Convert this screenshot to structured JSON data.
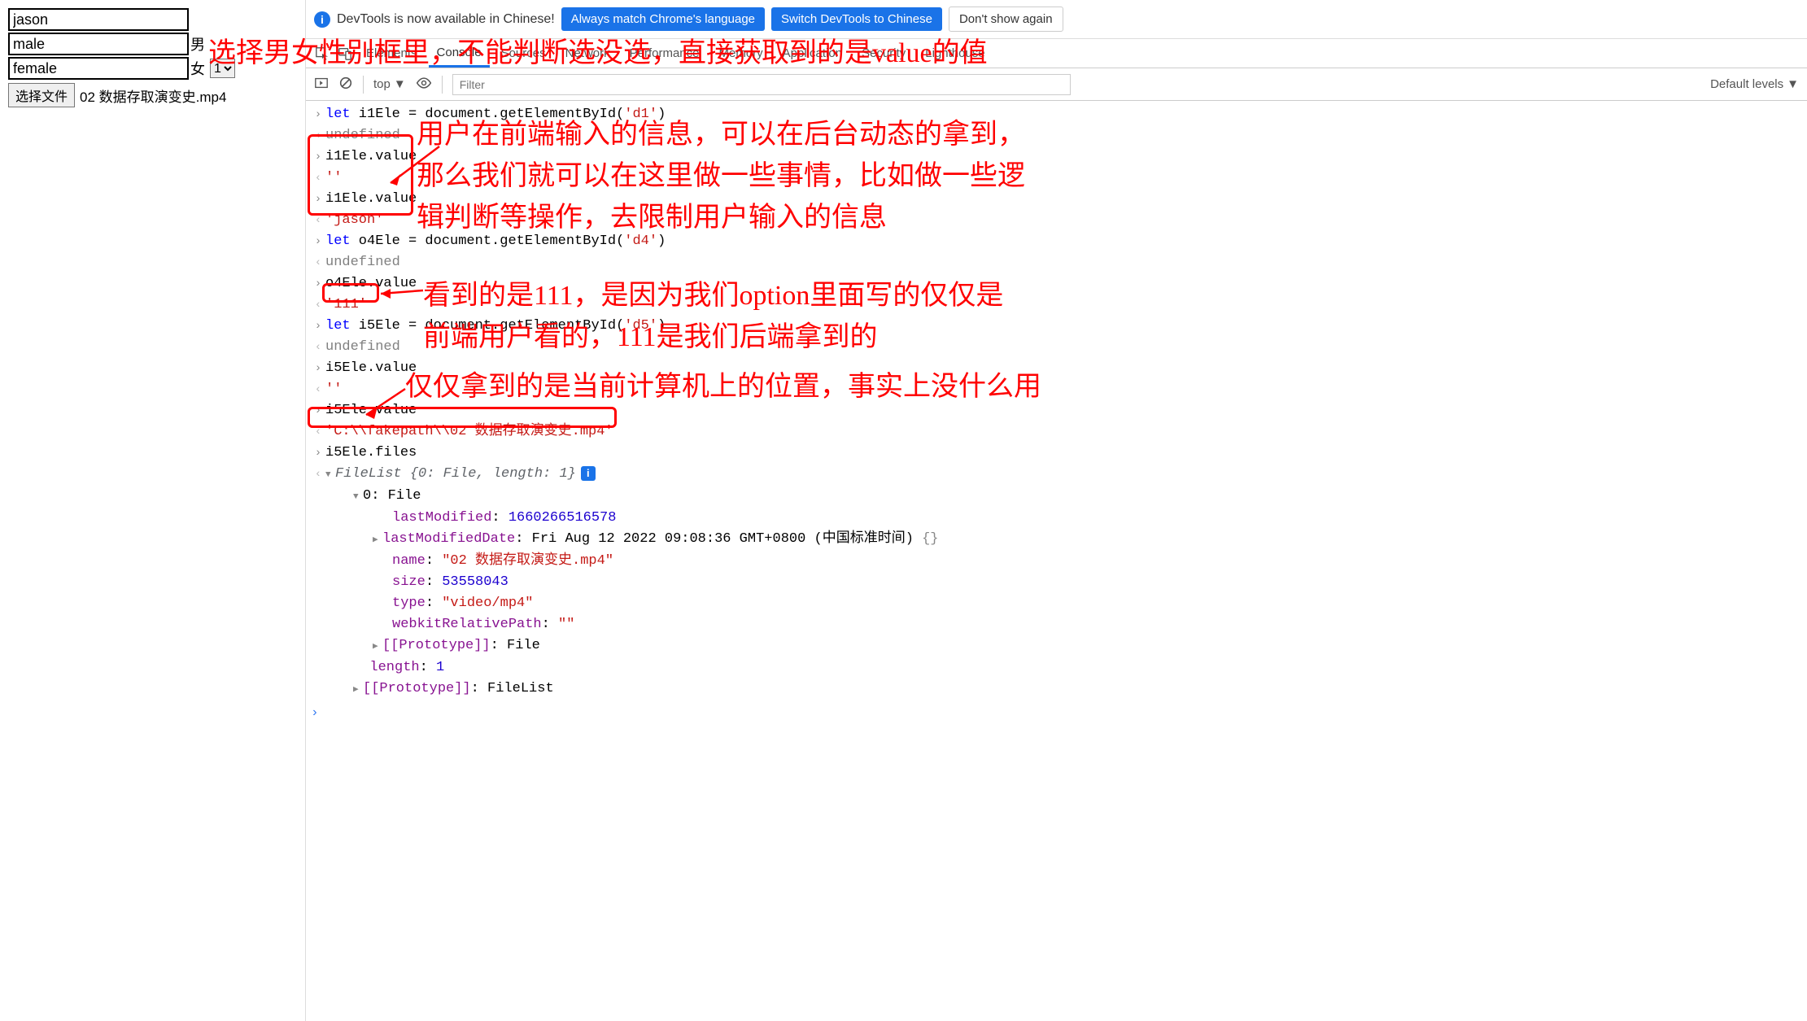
{
  "form": {
    "name_value": "jason",
    "male_value": "male",
    "male_label": "男",
    "female_value": "female",
    "female_label": "女",
    "select_value": "1",
    "file_button": "选择文件",
    "file_name": "02 数据存取演变史.mp4"
  },
  "infobar": {
    "text": "DevTools is now available in Chinese!",
    "btn_always": "Always match Chrome's language",
    "btn_switch": "Switch DevTools to Chinese",
    "btn_dont": "Don't show again"
  },
  "tabs": {
    "elements": "Elements",
    "console": "Console",
    "sources": "Sources",
    "network": "Network",
    "performance": "Performance",
    "memory": "Memory",
    "application": "Application",
    "security": "Security",
    "lighthouse": "Lighthouse"
  },
  "toolbar": {
    "context": "top",
    "filter_placeholder": "Filter",
    "levels": "Default levels"
  },
  "console_lines": {
    "l1_let": "let",
    "l1_rest": " i1Ele = document.getElementById(",
    "l1_arg": "'d1'",
    "l1_close": ")",
    "undefined": "undefined",
    "l3": "i1Ele.value",
    "l4": "''",
    "l5": "i1Ele.value",
    "l6": "'jason'",
    "l7_let": "let",
    "l7_rest": " o4Ele = document.getElementById(",
    "l7_arg": "'d4'",
    "l7_close": ")",
    "l9": "o4Ele.value",
    "l10": "'111'",
    "l11_let": "let",
    "l11_rest": " i5Ele = document.getElementById(",
    "l11_arg": "'d5'",
    "l11_close": ")",
    "l13": "i5Ele.value",
    "l14": "''",
    "l15": "i5Ele.value",
    "l16": "'C:\\\\fakepath\\\\02 数据存取演变史.mp4'",
    "l17": "i5Ele.files",
    "fl_head": "FileList {0: File, length: 1}",
    "fl_0": "0: File",
    "fl_lm_k": "lastModified",
    "fl_lm_v": "1660266516578",
    "fl_lmd_k": "lastModifiedDate",
    "fl_lmd_v": "Fri Aug 12 2022 09:08:36 GMT+0800 (中国标准时间)",
    "fl_lmd_end": " {}",
    "fl_name_k": "name",
    "fl_name_v": "\"02 数据存取演变史.mp4\"",
    "fl_size_k": "size",
    "fl_size_v": "53558043",
    "fl_type_k": "type",
    "fl_type_v": "\"video/mp4\"",
    "fl_wrp_k": "webkitRelativePath",
    "fl_wrp_v": "\"\"",
    "fl_proto1_k": "[[Prototype]]",
    "fl_proto1_v": "File",
    "fl_len_k": "length",
    "fl_len_v": "1",
    "fl_proto2_k": "[[Prototype]]",
    "fl_proto2_v": "FileList"
  },
  "annotations": {
    "a1": "选择男女性别框里，不能判断选没选，直接获取到的是value的值",
    "a2_l1": "用户在前端输入的信息，可以在后台动态的拿到，",
    "a2_l2": "那么我们就可以在这里做一些事情，比如做一些逻",
    "a2_l3": "辑判断等操作，去限制用户输入的信息",
    "a3_l1": "看到的是111，是因为我们option里面写的仅仅是",
    "a3_l2": "前端用户看的，111是我们后端拿到的",
    "a4": "仅仅拿到的是当前计算机上的位置，事实上没什么用"
  }
}
